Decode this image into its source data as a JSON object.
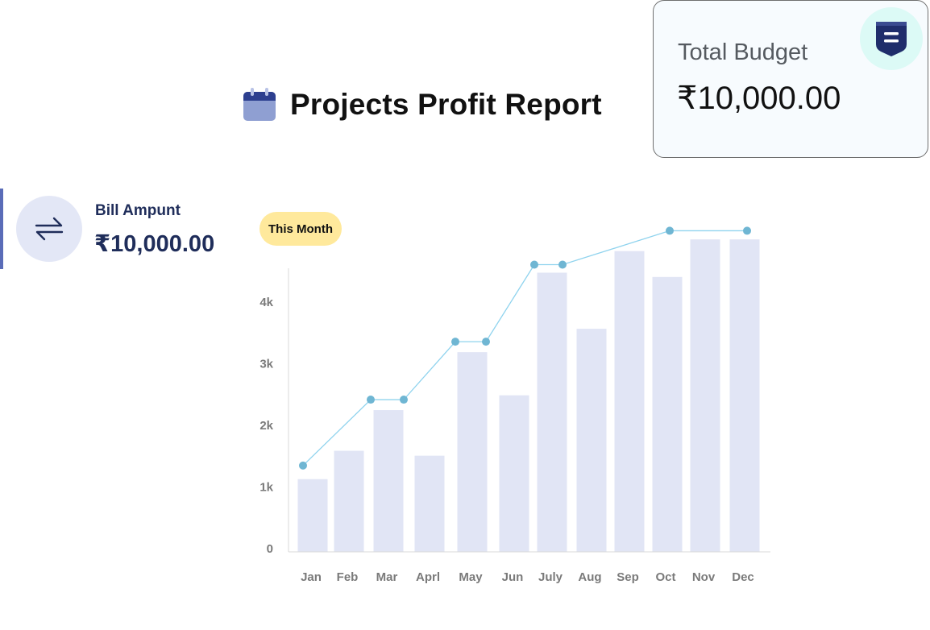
{
  "header": {
    "title": "Projects Profit Report",
    "title_icon": "calendar-icon"
  },
  "budget": {
    "label": "Total Budget",
    "value": "₹10,000.00",
    "icon": "bookmark-badge-icon"
  },
  "bill": {
    "label": "Bill Ampunt",
    "value": "₹10,000.00",
    "icon": "swap-arrows-icon"
  },
  "period": {
    "label": "This Month"
  },
  "colors": {
    "bar": "#e1e5f5",
    "line": "#8fd3ee",
    "point": "#6fb6d3",
    "accent": "#5a6cb8",
    "navy": "#1f2d5a",
    "pill": "#ffe99c"
  },
  "chart_data": {
    "type": "bar",
    "categories": [
      "Jan",
      "Feb",
      "Mar",
      "Aprl",
      "May",
      "Jun",
      "July",
      "Aug",
      "Sep",
      "Oct",
      "Nov",
      "Dec"
    ],
    "y_tick_labels": [
      "0",
      "1k",
      "2k",
      "3k",
      "4k"
    ],
    "y_tick_values": [
      0,
      1000,
      2000,
      3000,
      4000
    ],
    "ylim": [
      0,
      4500
    ],
    "series": [
      {
        "type": "bar",
        "values": [
          1180,
          1640,
          2300,
          1560,
          3240,
          2540,
          4530,
          3620,
          4880,
          4460,
          5070,
          5070
        ]
      },
      {
        "type": "line",
        "values": [
          1400,
          null,
          2470,
          2470,
          3410,
          3410,
          4660,
          4660,
          null,
          5210,
          null,
          5210
        ]
      }
    ],
    "grid": false
  }
}
